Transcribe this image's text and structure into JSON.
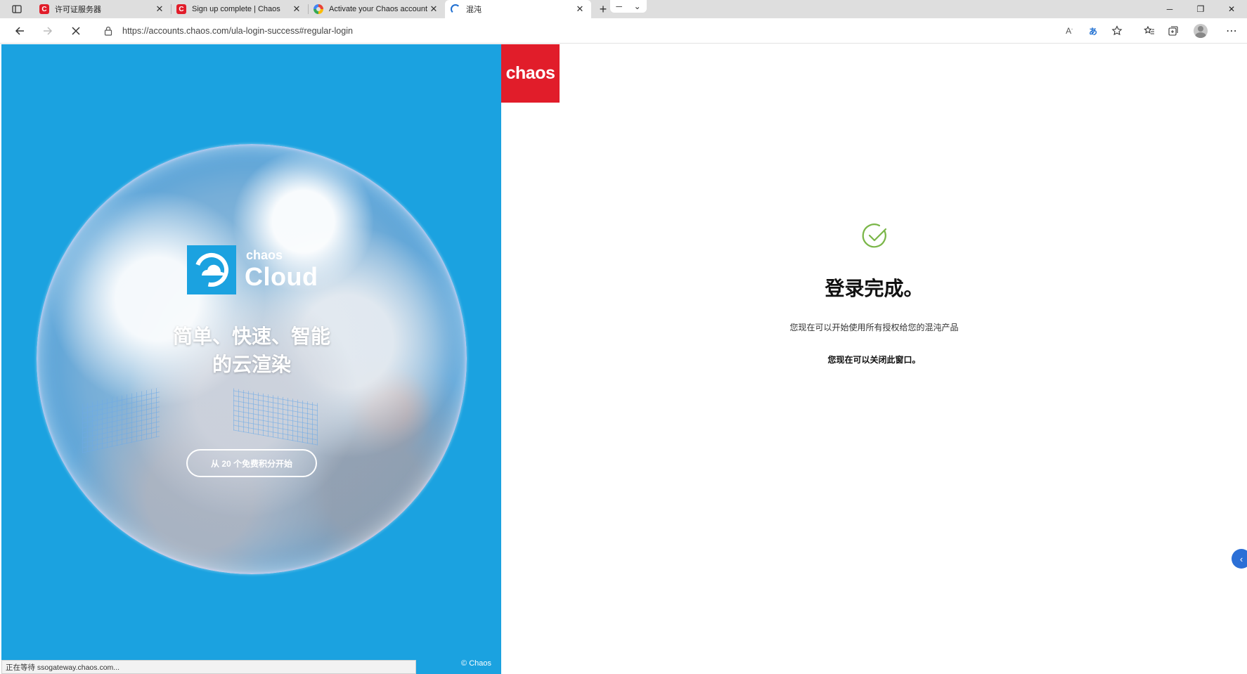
{
  "browser": {
    "tabs": [
      {
        "title": "许可证服务器",
        "icon": "chaos-favicon",
        "close": "✕"
      },
      {
        "title": "Sign up complete | Chaos",
        "icon": "chaos-favicon",
        "close": "✕"
      },
      {
        "title": "Activate your Chaos account - G",
        "icon": "chrome-favicon",
        "close": "✕"
      },
      {
        "title": "混沌",
        "icon": "loading-favicon",
        "close": "✕"
      }
    ],
    "active_tab": 3,
    "new_tab": "+",
    "address": {
      "url": "https://accounts.chaos.com/ula-login-success#regular-login"
    },
    "window_controls": {
      "minimize": "─",
      "restore": "❐",
      "close": "✕"
    }
  },
  "left": {
    "product_small": "chaos",
    "product_big": "Cloud",
    "headline_line1": "简单、快速、智能",
    "headline_line2": "的云渲染",
    "cta": "从 20 个免费积分开始",
    "copyright": "© Chaos",
    "background_color": "#1ba2e0"
  },
  "logo": {
    "text": "chaos",
    "color": "#e11d2a"
  },
  "main": {
    "title": "登录完成。",
    "subtitle": "您现在可以开始使用所有授权给您的混沌产品",
    "close_note": "您现在可以关闭此窗口。",
    "check_color": "#7ab648"
  },
  "status": {
    "text": "正在等待 ssogateway.chaos.com..."
  }
}
